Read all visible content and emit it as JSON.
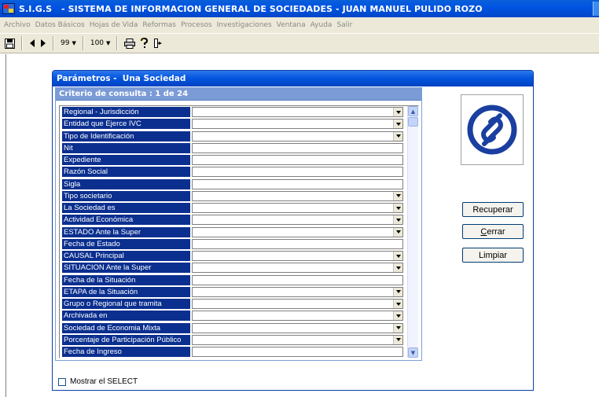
{
  "app": {
    "title": "S.I.G.S   - SISTEMA DE INFORMACION GENERAL DE SOCIEDADES - JUAN MANUEL PULIDO ROZO"
  },
  "menu": [
    "Archivo",
    "Datos Básicos",
    "Hojas de Vida",
    "Reformas",
    "Procesos",
    "Investigaciones",
    "Ventana",
    "Ayuda",
    "Salir"
  ],
  "toolbar": {
    "combo1_value": "99",
    "combo2_value": "100"
  },
  "dialog": {
    "title": "Parámetros -  Una Sociedad",
    "criteria_header": "Criterio de consulta : 1  de  24",
    "rows": [
      {
        "label": "Regional - Jurisdicción",
        "type": "dropdown",
        "value": ""
      },
      {
        "label": "Entidad que Ejerce IVC",
        "type": "dropdown",
        "value": ""
      },
      {
        "label": "Tipo de Identificación",
        "type": "dropdown",
        "value": ""
      },
      {
        "label": "Nit",
        "type": "text",
        "value": ""
      },
      {
        "label": "Expediente",
        "type": "text",
        "value": ""
      },
      {
        "label": "Razón Social",
        "type": "text",
        "value": ""
      },
      {
        "label": "Sigla",
        "type": "text",
        "value": ""
      },
      {
        "label": "Tipo societario",
        "type": "dropdown",
        "value": ""
      },
      {
        "label": "La Sociedad es",
        "type": "dropdown",
        "value": ""
      },
      {
        "label": "Actividad Económica",
        "type": "dropdown",
        "value": ""
      },
      {
        "label": "ESTADO Ante la Super",
        "type": "dropdown",
        "value": ""
      },
      {
        "label": "Fecha de Estado",
        "type": "text",
        "value": ""
      },
      {
        "label": "CAUSAL Principal",
        "type": "dropdown",
        "value": ""
      },
      {
        "label": "SITUACION Ante la Super",
        "type": "dropdown",
        "value": ""
      },
      {
        "label": "Fecha de la Situación",
        "type": "text",
        "value": ""
      },
      {
        "label": "ETAPA de la Situación",
        "type": "dropdown",
        "value": ""
      },
      {
        "label": "Grupo o Regional que tramita",
        "type": "dropdown",
        "value": ""
      },
      {
        "label": "Archivada en",
        "type": "dropdown",
        "value": ""
      },
      {
        "label": "Sociedad de Economia Mixta",
        "type": "dropdown",
        "value": ""
      },
      {
        "label": "Porcentaje de Participación Público",
        "type": "dropdown",
        "value": ""
      },
      {
        "label": "Fecha de Ingreso",
        "type": "text",
        "value": ""
      }
    ],
    "buttons": {
      "recuperar": "Recuperar",
      "cerrar_prefix": "C",
      "cerrar_rest": "errar",
      "limpiar": "Limpiar"
    },
    "show_select_label": "Mostrar el SELECT",
    "show_select_checked": false
  },
  "colors": {
    "titlebar": "#0054e3",
    "label_bg": "#0a2f8f",
    "criteria_header_bg": "#7b9bd6",
    "logo_blue": "#1a3fa0",
    "toolbar_bg": "#ece9d8"
  },
  "icons": {
    "save": "floppy-disk-icon",
    "prev": "triangle-left-icon",
    "next": "triangle-right-icon",
    "print": "printer-icon",
    "help": "question-mark-icon",
    "exit": "exit-door-icon",
    "logo": "supersociedades-logo"
  }
}
